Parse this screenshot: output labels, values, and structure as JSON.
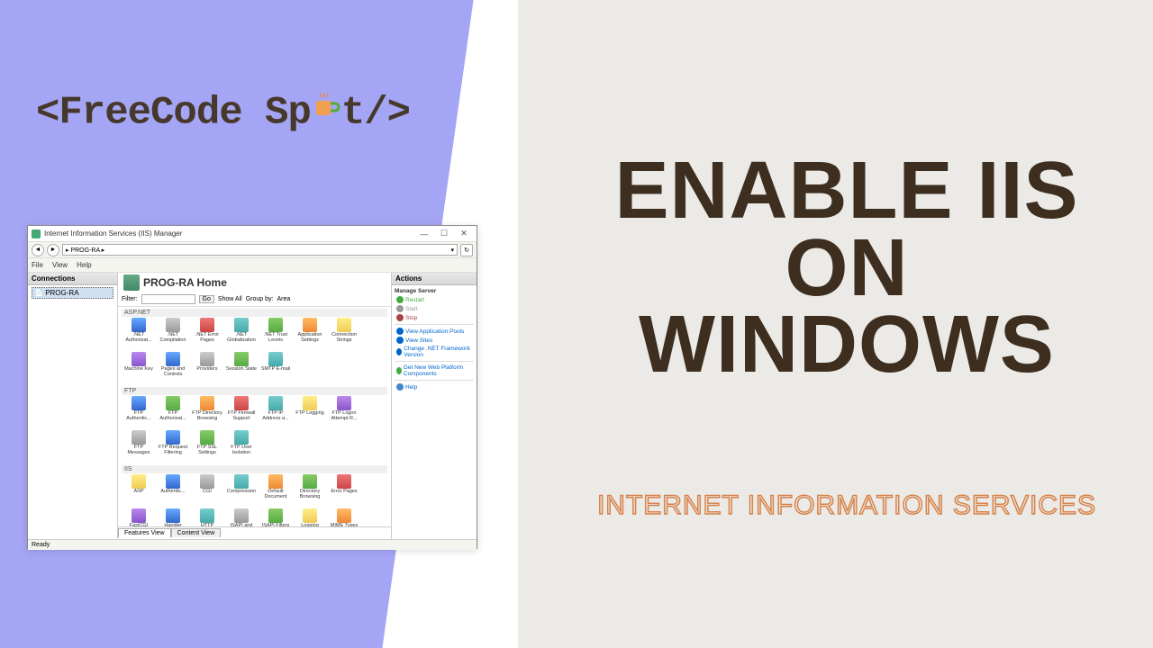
{
  "logo": {
    "open": "<FreeCode Sp",
    "close": "t/>"
  },
  "headline": "ENABLE IIS ON WINDOWS",
  "subtitle": "INTERNET INFORMATION SERVICES",
  "iis": {
    "title": "Internet Information Services (IIS) Manager",
    "address": "▸ PROG-RA ▸",
    "menu": [
      "File",
      "View",
      "Help"
    ],
    "left_header": "Connections",
    "tree_node": "PROG-RA",
    "page_title": "PROG-RA Home",
    "filter": {
      "label": "Filter:",
      "go": "Go",
      "show_all": "Show All",
      "group_label": "Group by:",
      "group_by": "Area"
    },
    "tabs": [
      "Features View",
      "Content View"
    ],
    "right_header": "Actions",
    "status": "Ready",
    "sections": [
      {
        "label": "ASP.NET",
        "icons": [
          {
            "l": ".NET Authorizat...",
            "c": "c-blue"
          },
          {
            "l": ".NET Compilation",
            "c": "c-gray"
          },
          {
            "l": ".NET Error Pages",
            "c": "c-red"
          },
          {
            "l": ".NET Globalization",
            "c": "c-teal"
          },
          {
            "l": ".NET Trust Levels",
            "c": "c-green"
          },
          {
            "l": "Application Settings",
            "c": "c-orange"
          },
          {
            "l": "Connection Strings",
            "c": "c-yellow"
          },
          {
            "l": "Machine Key",
            "c": "c-purple"
          },
          {
            "l": "Pages and Controls",
            "c": "c-blue"
          },
          {
            "l": "Providers",
            "c": "c-gray"
          },
          {
            "l": "Session State",
            "c": "c-green"
          },
          {
            "l": "SMTP E-mail",
            "c": "c-teal"
          }
        ]
      },
      {
        "label": "FTP",
        "icons": [
          {
            "l": "FTP Authentic...",
            "c": "c-blue"
          },
          {
            "l": "FTP Authorizat...",
            "c": "c-green"
          },
          {
            "l": "FTP Directory Browsing",
            "c": "c-orange"
          },
          {
            "l": "FTP Firewall Support",
            "c": "c-red"
          },
          {
            "l": "FTP IP Address a...",
            "c": "c-teal"
          },
          {
            "l": "FTP Logging",
            "c": "c-yellow"
          },
          {
            "l": "FTP Logon Attempt R...",
            "c": "c-purple"
          },
          {
            "l": "FTP Messages",
            "c": "c-gray"
          },
          {
            "l": "FTP Request Filtering",
            "c": "c-blue"
          },
          {
            "l": "FTP SSL Settings",
            "c": "c-green"
          },
          {
            "l": "FTP User Isolation",
            "c": "c-teal"
          }
        ]
      },
      {
        "label": "IIS",
        "icons": [
          {
            "l": "ASP",
            "c": "c-yellow"
          },
          {
            "l": "Authentic...",
            "c": "c-blue"
          },
          {
            "l": "CGI",
            "c": "c-gray"
          },
          {
            "l": "Compression",
            "c": "c-teal"
          },
          {
            "l": "Default Document",
            "c": "c-orange"
          },
          {
            "l": "Directory Browsing",
            "c": "c-green"
          },
          {
            "l": "Error Pages",
            "c": "c-red"
          },
          {
            "l": "FastCGI Settings",
            "c": "c-purple"
          },
          {
            "l": "Handler Mappings",
            "c": "c-blue"
          },
          {
            "l": "HTTP Respon...",
            "c": "c-teal"
          },
          {
            "l": "ISAPI and CGI Restr...",
            "c": "c-gray"
          },
          {
            "l": "ISAPI Filters",
            "c": "c-green"
          },
          {
            "l": "Logging",
            "c": "c-yellow"
          },
          {
            "l": "MIME Types",
            "c": "c-orange"
          }
        ]
      }
    ],
    "actions": [
      {
        "type": "group",
        "l": "Manage Server"
      },
      {
        "type": "action",
        "l": "Restart",
        "c": "#4a4"
      },
      {
        "type": "action",
        "l": "Start",
        "c": "#999"
      },
      {
        "type": "action",
        "l": "Stop",
        "c": "#a44"
      },
      {
        "type": "sep"
      },
      {
        "type": "action",
        "l": "View Application Pools",
        "c": "#06c"
      },
      {
        "type": "action",
        "l": "View Sites",
        "c": "#06c"
      },
      {
        "type": "action",
        "l": "Change .NET Framework Version",
        "c": "#06c"
      },
      {
        "type": "sep"
      },
      {
        "type": "action",
        "l": "Get New Web Platform Components",
        "c": "#06c",
        "i": "#4a4"
      },
      {
        "type": "sep"
      },
      {
        "type": "action",
        "l": "Help",
        "c": "#06c",
        "i": "#48c"
      }
    ]
  }
}
